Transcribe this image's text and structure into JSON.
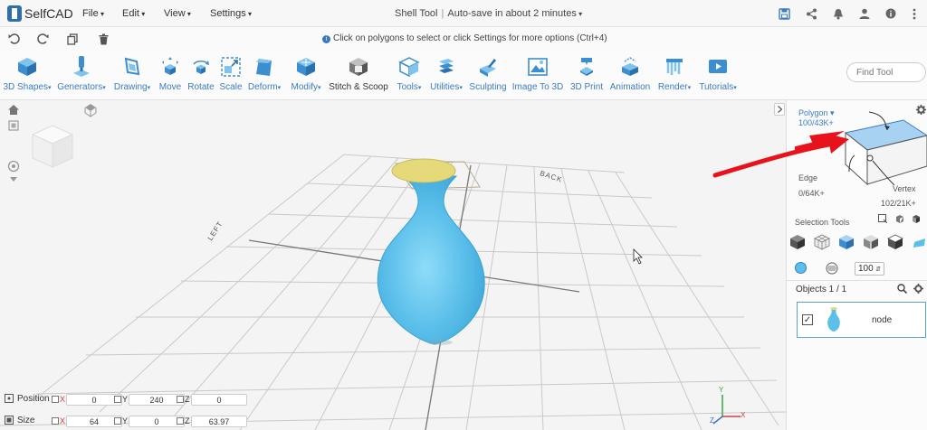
{
  "app": {
    "logo_text": "SelfCAD",
    "menus": [
      "File",
      "Edit",
      "View",
      "Settings"
    ],
    "tool_title": "Shell Tool",
    "autosave": "Auto-save in about 2 minutes"
  },
  "header_icons": [
    "save-icon",
    "share-icon",
    "bell-icon",
    "user-icon",
    "info-icon",
    "more-vertical-icon"
  ],
  "row2": {
    "actions": [
      "undo-icon",
      "redo-icon",
      "copy-icon",
      "trash-icon"
    ],
    "hint": "Click on polygons to select or click Settings for more options (Ctrl+4)"
  },
  "toolbar": {
    "tools": [
      {
        "label": "3D Shapes",
        "icon": "cube-icon",
        "dropdown": true
      },
      {
        "label": "Generators",
        "icon": "generator-icon",
        "dropdown": true
      },
      {
        "label": "Drawing",
        "icon": "drawing-icon",
        "dropdown": true
      },
      {
        "label": "Move",
        "icon": "move-icon",
        "dropdown": false
      },
      {
        "label": "Rotate",
        "icon": "rotate-icon",
        "dropdown": false
      },
      {
        "label": "Scale",
        "icon": "scale-icon",
        "dropdown": false
      },
      {
        "label": "Deform",
        "icon": "deform-icon",
        "dropdown": true
      },
      {
        "label": "Modify",
        "icon": "modify-icon",
        "dropdown": true
      },
      {
        "label": "Stitch & Scoop",
        "icon": "stitch-scoop-icon",
        "dropdown": false
      },
      {
        "label": "Tools",
        "icon": "tools-icon",
        "dropdown": true
      },
      {
        "label": "Utilities",
        "icon": "utilities-icon",
        "dropdown": true
      },
      {
        "label": "Sculpting",
        "icon": "sculpting-icon",
        "dropdown": false
      },
      {
        "label": "Image To 3D",
        "icon": "image-to-3d-icon",
        "dropdown": false
      },
      {
        "label": "3D Print",
        "icon": "3d-print-icon",
        "dropdown": false
      },
      {
        "label": "Animation",
        "icon": "animation-icon",
        "dropdown": false
      },
      {
        "label": "Render",
        "icon": "render-icon",
        "dropdown": true
      },
      {
        "label": "Tutorials",
        "icon": "tutorials-icon",
        "dropdown": true
      }
    ],
    "find_tool_placeholder": "Find Tool"
  },
  "viewport": {
    "labels": {
      "back": "BACK",
      "left": "LEFT"
    },
    "axis_labels": {
      "y": "Y",
      "x": "X",
      "z": "Z"
    }
  },
  "transform": {
    "position": {
      "label": "Position",
      "x": "0",
      "y": "240",
      "z": "0"
    },
    "size": {
      "label": "Size",
      "x": "64",
      "y": "0",
      "z": "63.97"
    },
    "axes": {
      "x": "X",
      "y": "Y",
      "z": "Z"
    }
  },
  "right_panel": {
    "polygon_label": "Polygon",
    "polygon_count": "100/43K+",
    "edge_label": "Edge",
    "edge_count": "0/64K+",
    "vertex_label": "Vertex",
    "vertex_count": "102/21K+",
    "selection_tools_label": "Selection Tools",
    "brush_size": "100",
    "objects_label": "Objects 1 / 1",
    "object_name": "node",
    "colors": {
      "accent": "#3b7cc6",
      "vase": "#5bbfea",
      "vase_rim": "#e6d97a",
      "arrow": "#e8121d",
      "selection_face": "#a8d2f2"
    }
  }
}
